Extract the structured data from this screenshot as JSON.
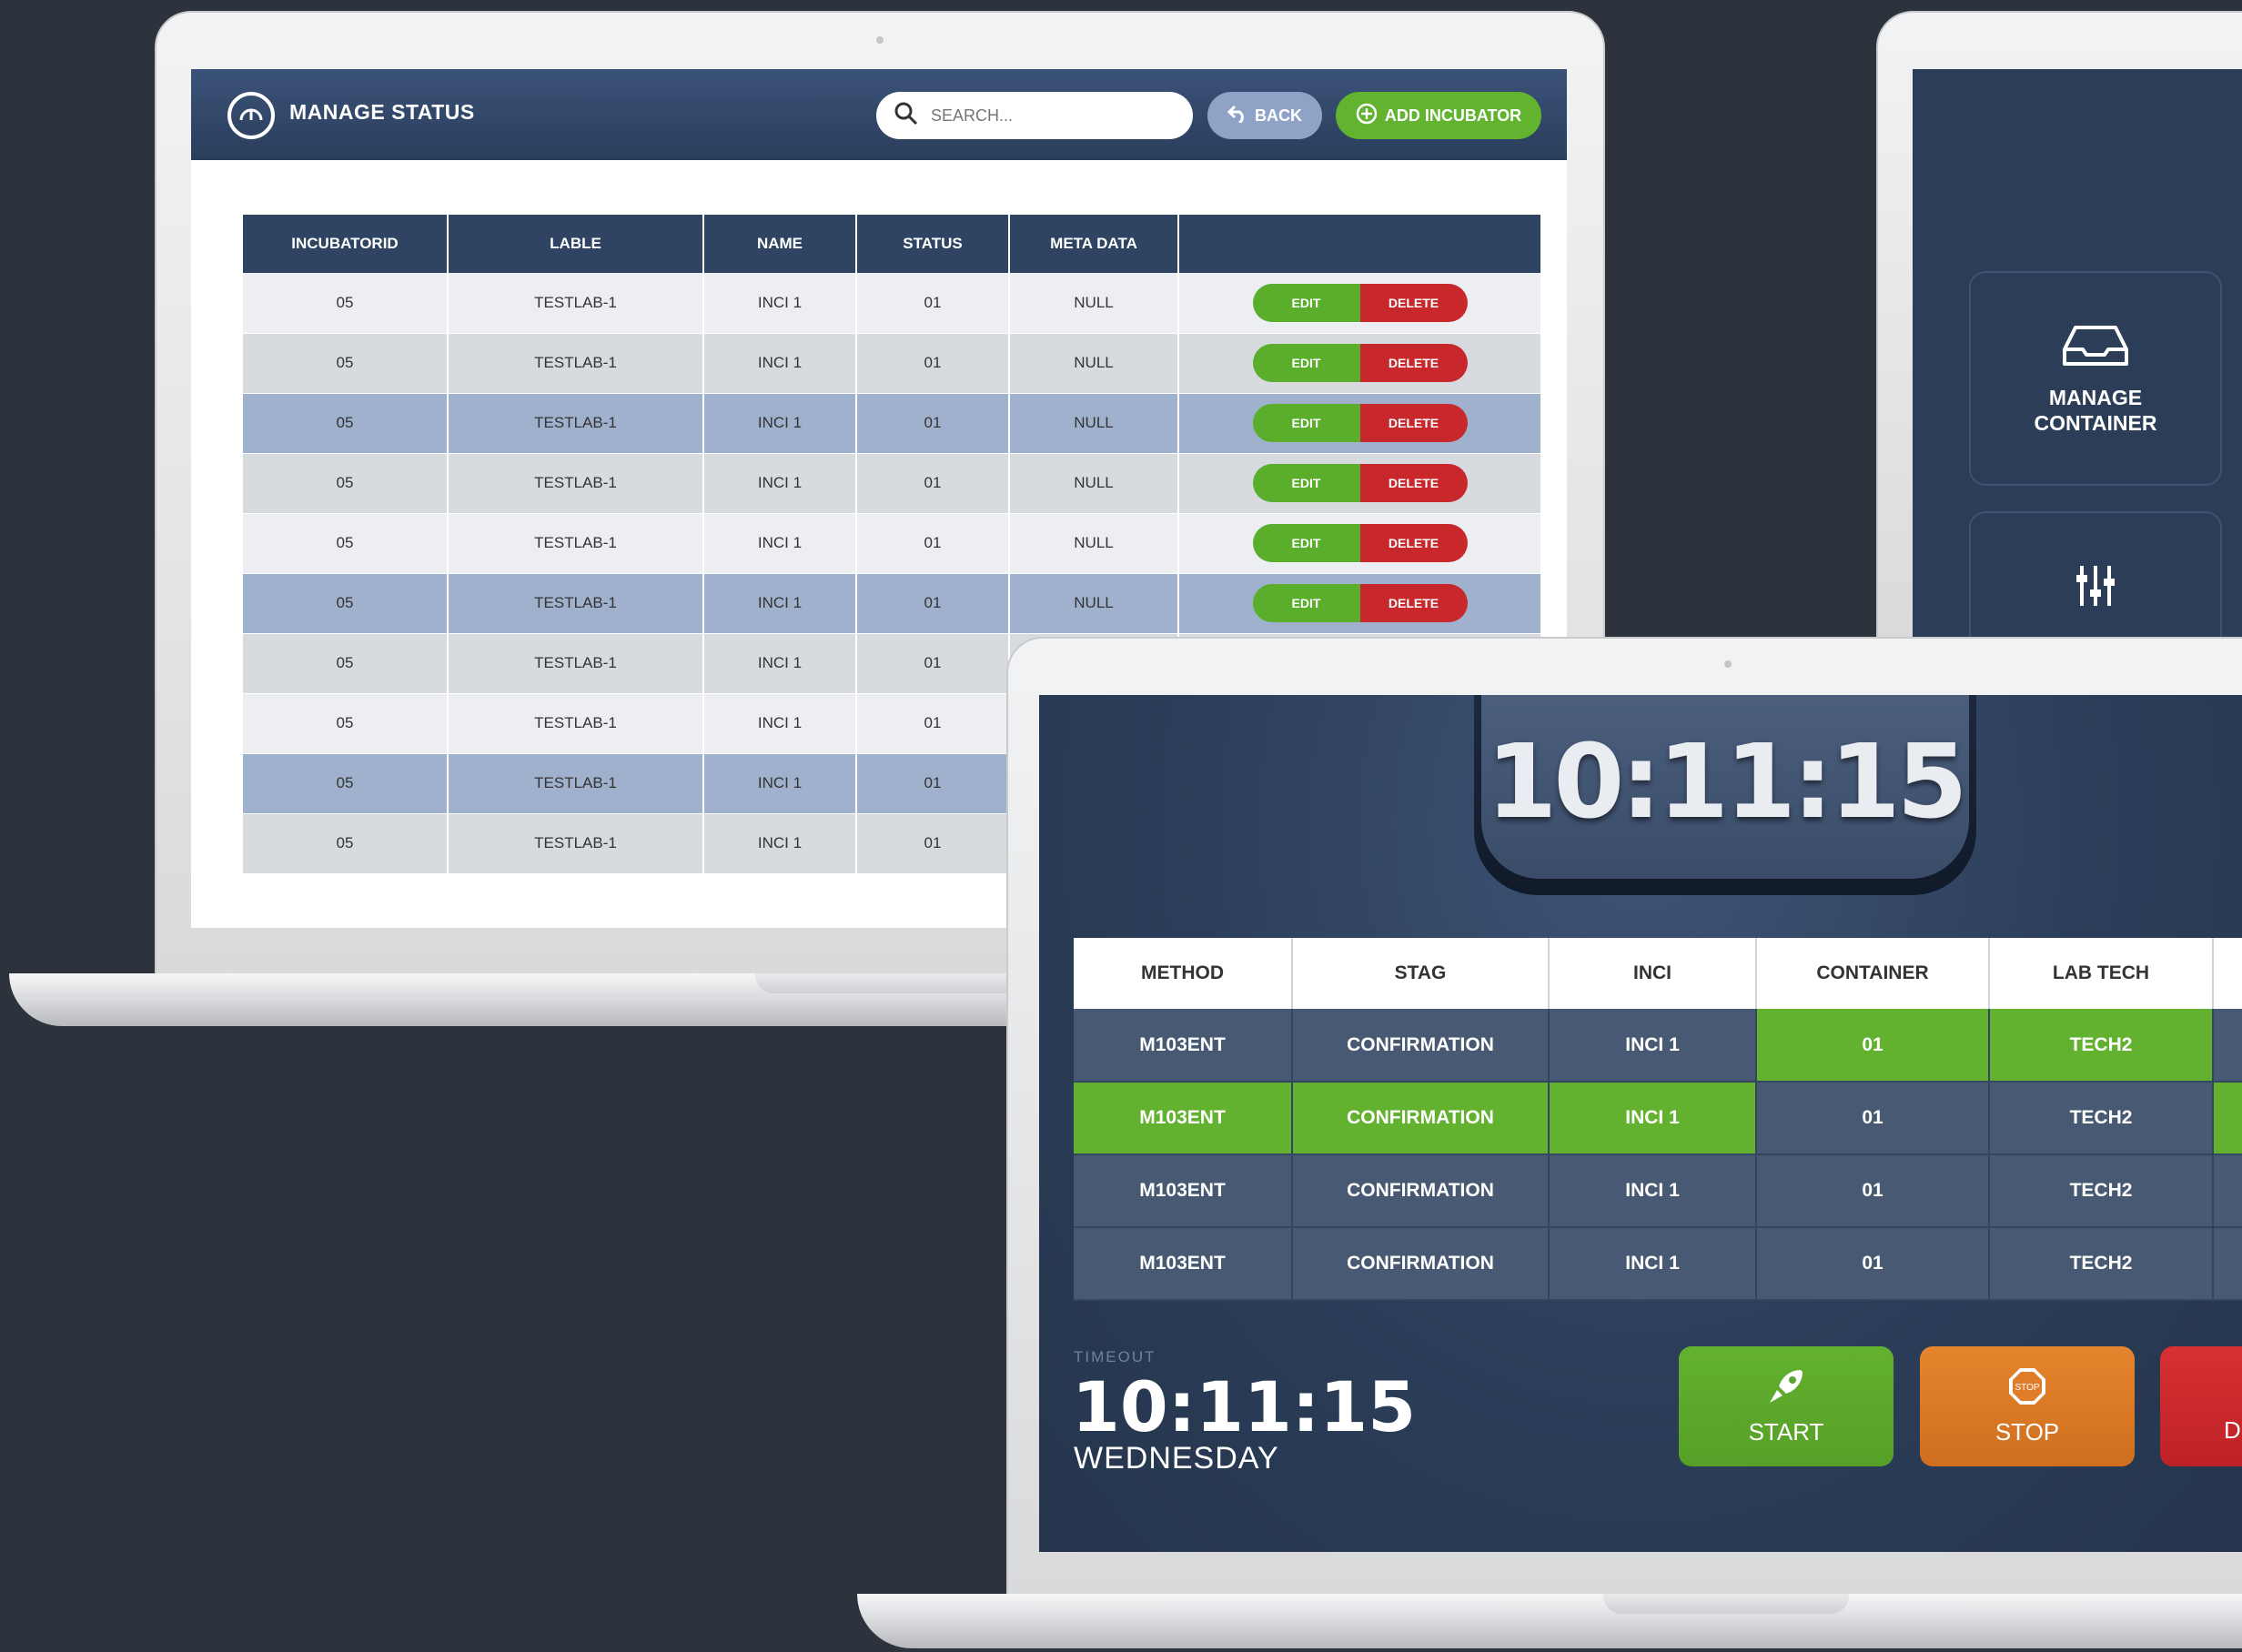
{
  "manage_status": {
    "title": "MANAGE STATUS",
    "search_placeholder": "SEARCH...",
    "back_label": "BACK",
    "add_label": "ADD INCUBATOR",
    "columns": [
      "INCUBATORID",
      "LABLE",
      "NAME",
      "STATUS",
      "META DATA",
      ""
    ],
    "rows": [
      [
        "05",
        "TESTLAB-1",
        "INCI 1",
        "01",
        "NULL"
      ],
      [
        "05",
        "TESTLAB-1",
        "INCI 1",
        "01",
        "NULL"
      ],
      [
        "05",
        "TESTLAB-1",
        "INCI 1",
        "01",
        "NULL"
      ],
      [
        "05",
        "TESTLAB-1",
        "INCI 1",
        "01",
        "NULL"
      ],
      [
        "05",
        "TESTLAB-1",
        "INCI 1",
        "01",
        "NULL"
      ],
      [
        "05",
        "TESTLAB-1",
        "INCI 1",
        "01",
        "NULL"
      ],
      [
        "05",
        "TESTLAB-1",
        "INCI 1",
        "01",
        ""
      ],
      [
        "05",
        "TESTLAB-1",
        "INCI 1",
        "01",
        ""
      ],
      [
        "05",
        "TESTLAB-1",
        "INCI 1",
        "01",
        ""
      ],
      [
        "05",
        "TESTLAB-1",
        "INCI 1",
        "01",
        ""
      ]
    ],
    "edit_label": "EDIT",
    "delete_label": "DELETE"
  },
  "side_menu": {
    "tile1_label_line1": "MANAGE",
    "tile1_label_line2": "CONTAINER"
  },
  "timer_screen": {
    "clock": "10:11:15",
    "columns": [
      "METHOD",
      "STAG",
      "INCI",
      "CONTAINER",
      "LAB TECH"
    ],
    "rows": [
      [
        "M103ENT",
        "CONFIRMATION",
        "INCI 1",
        "01",
        "TECH2"
      ],
      [
        "M103ENT",
        "CONFIRMATION",
        "INCI 1",
        "01",
        "TECH2"
      ],
      [
        "M103ENT",
        "CONFIRMATION",
        "INCI 1",
        "01",
        "TECH2"
      ],
      [
        "M103ENT",
        "CONFIRMATION",
        "INCI 1",
        "01",
        "TECH2"
      ]
    ],
    "timeout_label": "TIMEOUT",
    "timeout_time": "10:11:15",
    "timeout_day": "WEDNESDAY",
    "start_label": "START",
    "stop_label": "STOP",
    "stop_sign_text": "STOP",
    "third_label": "D"
  },
  "colors": {
    "background": "#2d333c",
    "header_blue": "#2f4462",
    "green": "#62b32f",
    "red": "#c8272c",
    "orange": "#e07d2a",
    "highlight_row": "#a0b1cd"
  }
}
